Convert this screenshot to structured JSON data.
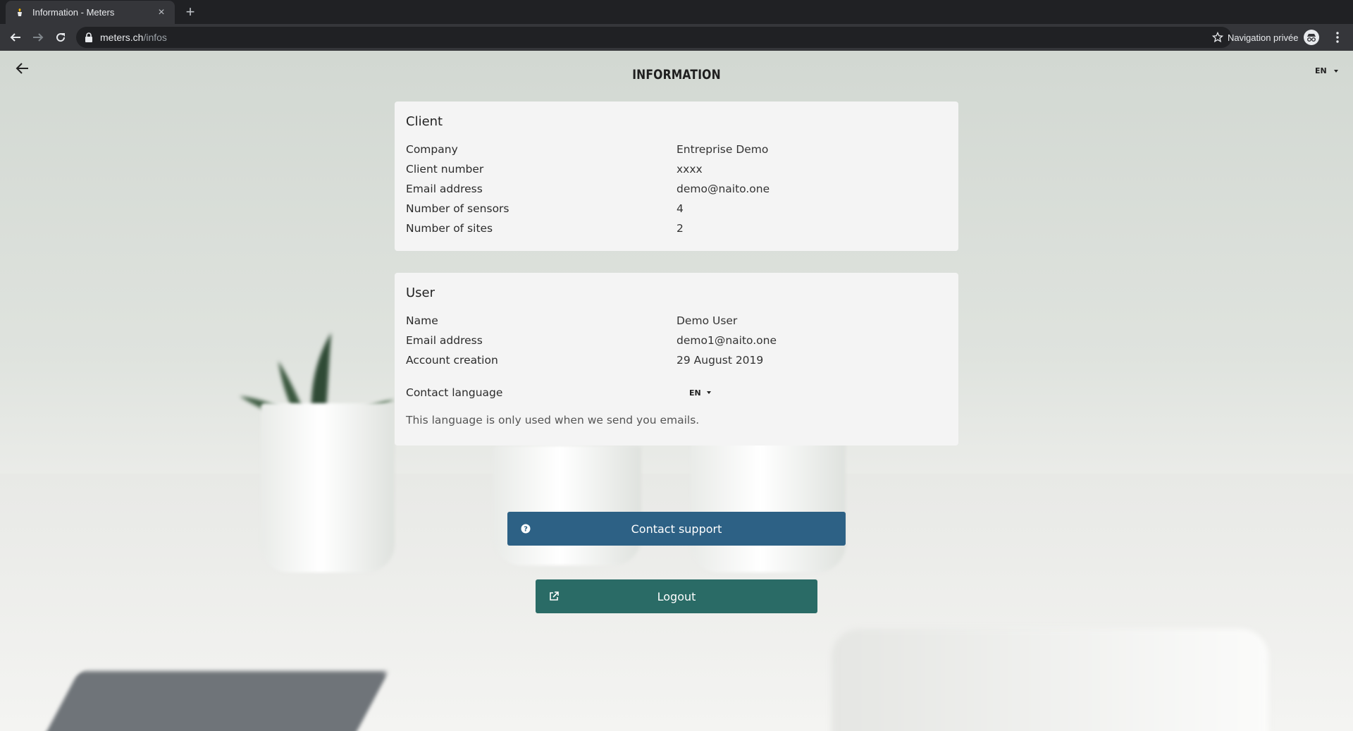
{
  "browser": {
    "tab_title": "Information - Meters",
    "url_host": "meters.ch",
    "url_path": "/infos",
    "incognito_label": "Navigation privée"
  },
  "page": {
    "title": "INFORMATION",
    "language": "EN"
  },
  "client": {
    "heading": "Client",
    "rows": [
      {
        "label": "Company",
        "value": "Entreprise Demo"
      },
      {
        "label": "Client number",
        "value": "xxxx"
      },
      {
        "label": "Email address",
        "value": "demo@naito.one"
      },
      {
        "label": "Number of sensors",
        "value": "4"
      },
      {
        "label": "Number of sites",
        "value": "2"
      }
    ]
  },
  "user": {
    "heading": "User",
    "rows": [
      {
        "label": "Name",
        "value": "Demo User"
      },
      {
        "label": "Email address",
        "value": "demo1@naito.one"
      },
      {
        "label": "Account creation",
        "value": "29 August 2019"
      }
    ],
    "contact_language_label": "Contact language",
    "contact_language_value": "EN",
    "hint": "This language is only used when we send you emails."
  },
  "actions": {
    "support_label": "Contact support",
    "logout_label": "Logout"
  },
  "colors": {
    "support_button": "#2d6185",
    "logout_button": "#2a6b66",
    "card_background": "#f4f4f4"
  }
}
